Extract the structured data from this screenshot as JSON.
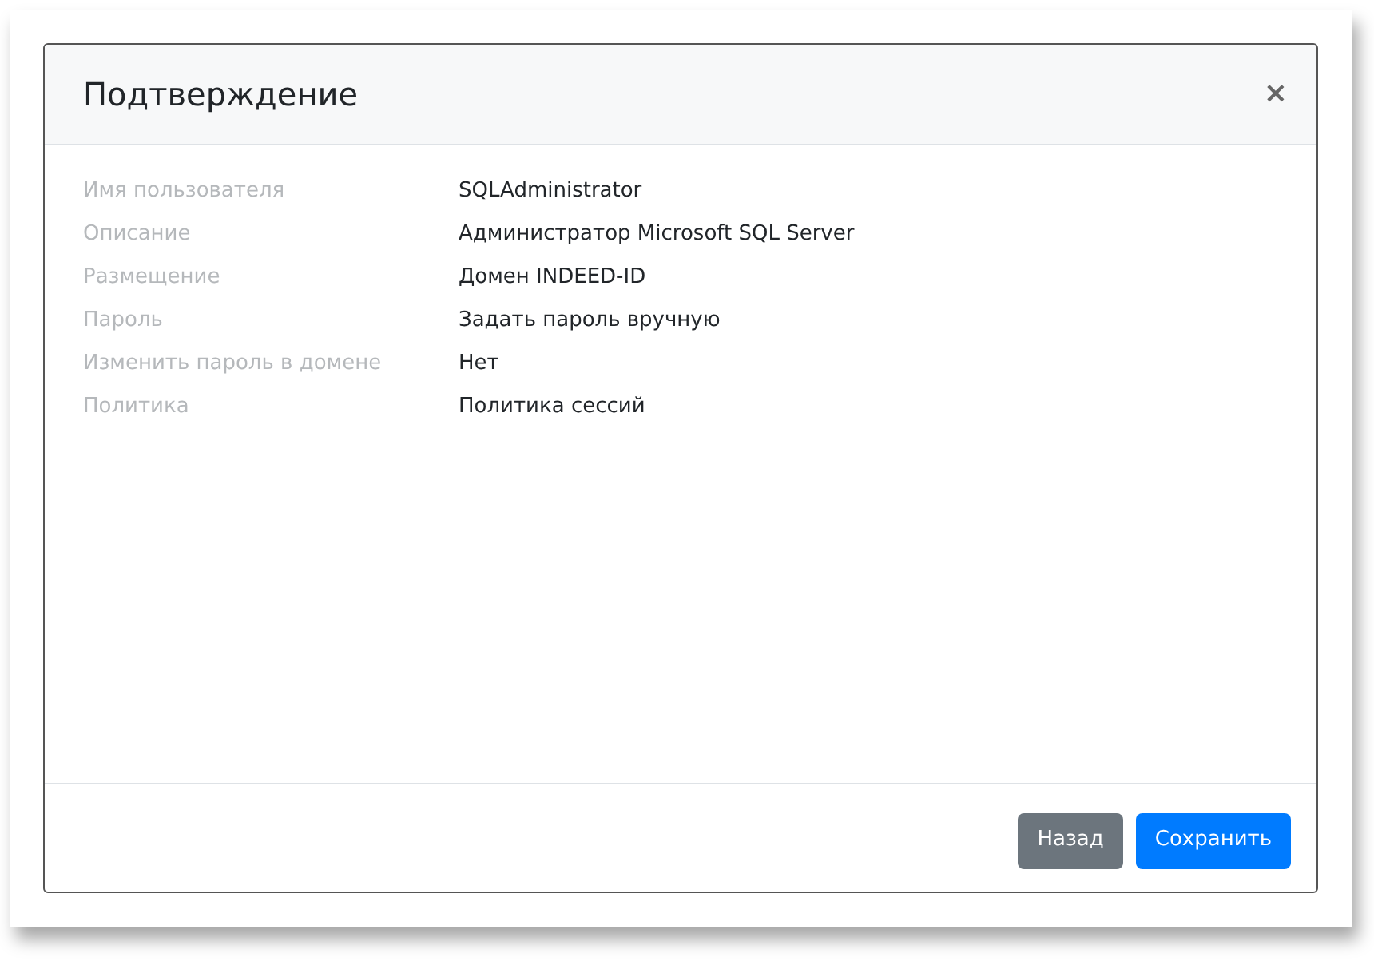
{
  "dialog": {
    "title": "Подтверждение",
    "close": "×"
  },
  "fields": [
    {
      "label": "Имя пользователя",
      "value": "SQLAdministrator"
    },
    {
      "label": "Описание",
      "value": "Администратор Microsoft SQL Server"
    },
    {
      "label": "Размещение",
      "value": "Домен INDEED-ID"
    },
    {
      "label": "Пароль",
      "value": "Задать пароль вручную"
    },
    {
      "label": "Изменить пароль в домене",
      "value": "Нет"
    },
    {
      "label": "Политика",
      "value": "Политика сессий"
    }
  ],
  "buttons": [
    {
      "label": "Назад",
      "kind": "secondary"
    },
    {
      "label": "Сохранить",
      "kind": "primary"
    }
  ]
}
